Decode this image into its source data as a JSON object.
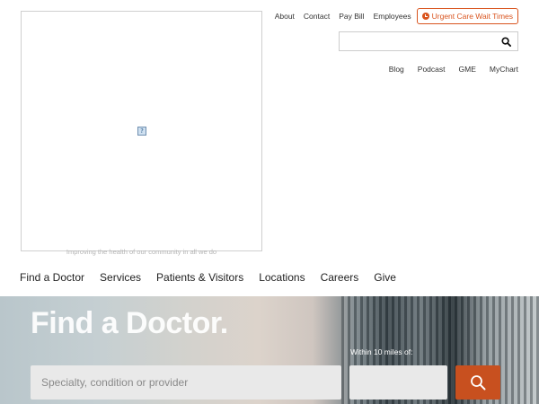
{
  "logo": {
    "broken_image_glyph": "?",
    "tagline": "Improving the health of our community in all we do"
  },
  "utility_nav": {
    "items": [
      "About",
      "Contact",
      "Pay Bill",
      "Employees"
    ],
    "urgent_care": {
      "label": "Urgent Care Wait Times",
      "icon": "clock-icon",
      "color": "#d9541e"
    }
  },
  "site_search": {
    "placeholder": "",
    "icon": "search-icon"
  },
  "secondary_nav": {
    "items": [
      "Blog",
      "Podcast",
      "GME",
      "MyChart"
    ]
  },
  "main_nav": {
    "items": [
      "Find a Doctor",
      "Services",
      "Patients & Visitors",
      "Locations",
      "Careers",
      "Give"
    ]
  },
  "hero": {
    "title": "Find a Doctor.",
    "within_label": "Within 10 miles of:",
    "specialty_placeholder": "Specialty, condition or provider",
    "zip_placeholder": "",
    "search_button_icon": "search-icon",
    "accent_color": "#c8501f"
  }
}
